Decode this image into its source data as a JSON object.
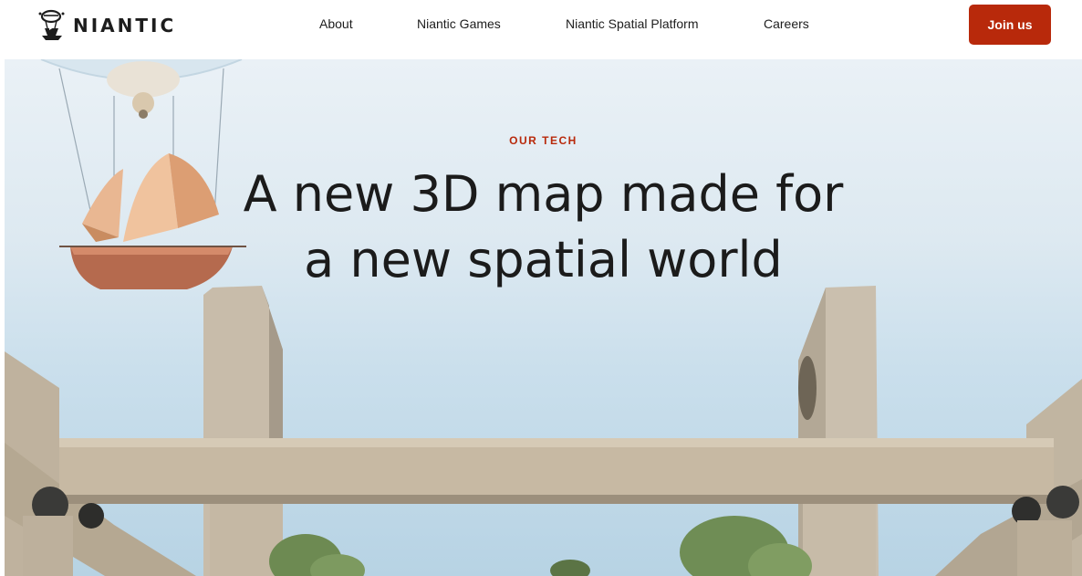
{
  "header": {
    "logo_text": "NIANTIC",
    "nav": [
      {
        "label": "About"
      },
      {
        "label": "Niantic Games"
      },
      {
        "label": "Niantic Spatial Platform"
      },
      {
        "label": "Careers"
      }
    ],
    "cta_label": "Join us"
  },
  "hero": {
    "eyebrow": "OUR TECH",
    "headline_line1": "A new 3D map made for",
    "headline_line2": "a new spatial world"
  },
  "colors": {
    "accent": "#b8290b",
    "text": "#1b1b1b",
    "sky": "#dde9f1"
  },
  "icons": {
    "logo": "niantic-airship-logo-icon"
  }
}
